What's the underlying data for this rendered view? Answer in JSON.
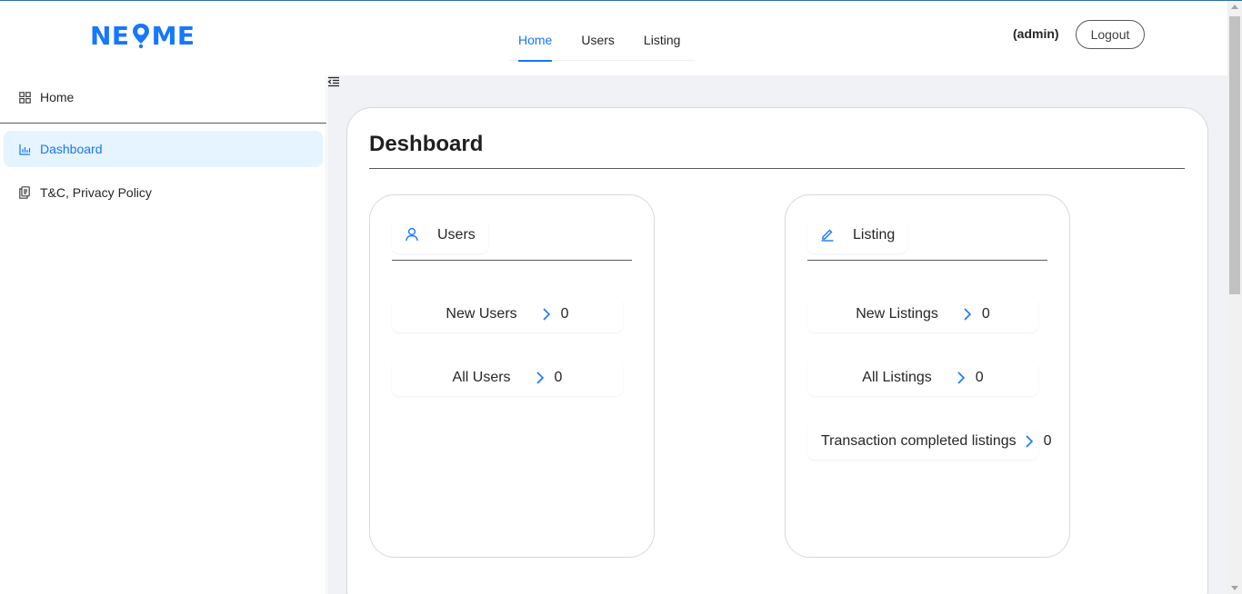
{
  "header": {
    "logo_left": "NE",
    "logo_right": "ME",
    "nav": [
      "Home",
      "Users",
      "Listing"
    ],
    "user_label": "(admin)",
    "logout_label": "Logout"
  },
  "sidebar": {
    "items": [
      {
        "label": "Home",
        "icon": "appstore-icon"
      },
      {
        "label": "Dashboard",
        "icon": "bar-chart-icon"
      },
      {
        "label": "T&C, Privacy Policy",
        "icon": "copy-icon"
      }
    ]
  },
  "main": {
    "title": "Deshboard",
    "cards": [
      {
        "title": "Users",
        "icon": "user-icon",
        "rows": [
          {
            "label": "New Users",
            "count": "0"
          },
          {
            "label": "All Users",
            "count": "0"
          }
        ]
      },
      {
        "title": "Listing",
        "icon": "edit-icon",
        "rows": [
          {
            "label": "New Listings",
            "count": "0"
          },
          {
            "label": "All Listings",
            "count": "0"
          },
          {
            "label": "Transaction completed listings",
            "count": "0"
          }
        ]
      }
    ]
  },
  "colors": {
    "accent": "#1677ff",
    "active_bg": "#e6f4ff",
    "content_bg": "#f0f2f5"
  }
}
